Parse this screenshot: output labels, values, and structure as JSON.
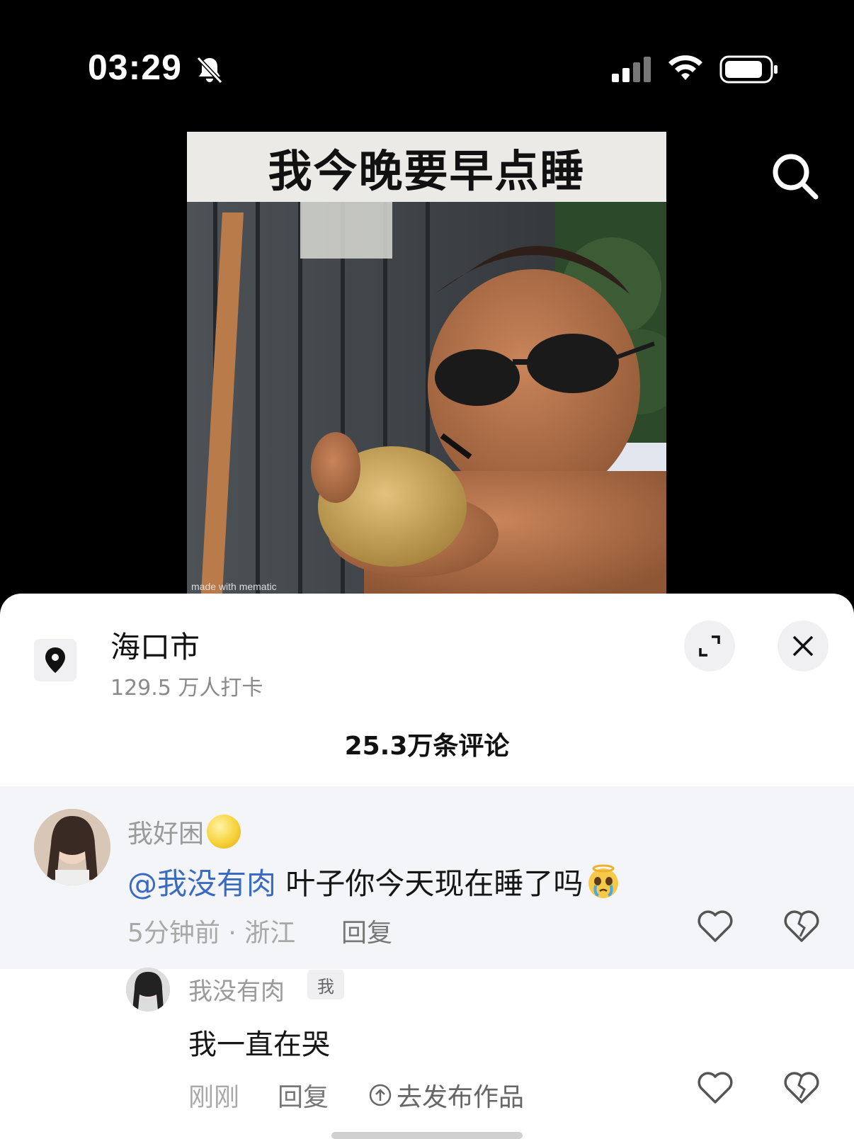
{
  "status_bar": {
    "time": "03:29",
    "icons": [
      "bell-slash-icon",
      "signal-icon",
      "wifi-icon",
      "battery-icon"
    ]
  },
  "video": {
    "caption": "我今晚要早点睡",
    "watermark": "made with mematic",
    "search_icon": "search-icon"
  },
  "location": {
    "title": "海口市",
    "subtitle": "129.5 万人打卡",
    "icon": "map-pin-icon"
  },
  "header_buttons": {
    "expand_icon": "expand-icon",
    "close_icon": "close-icon"
  },
  "comments": {
    "count_label": "25.3万条评论",
    "main": {
      "author": "我好困",
      "author_emoji": "moon-emoji",
      "mention": "@我没有肉",
      "text": " 叶子你今天现在睡了吗",
      "text_emoji": "crying-emoji",
      "meta": "5分钟前 · 浙江",
      "reply_label": "回复"
    },
    "reply": {
      "author": "我没有肉",
      "badge": "我",
      "text": "我一直在哭",
      "meta": "刚刚",
      "reply_label": "回复",
      "publish_label": "去发布作品"
    }
  },
  "colors": {
    "background_top": "#000000",
    "sheet": "#ffffff",
    "highlight_row": "#f4f5f8",
    "mention": "#3a6bc2"
  }
}
